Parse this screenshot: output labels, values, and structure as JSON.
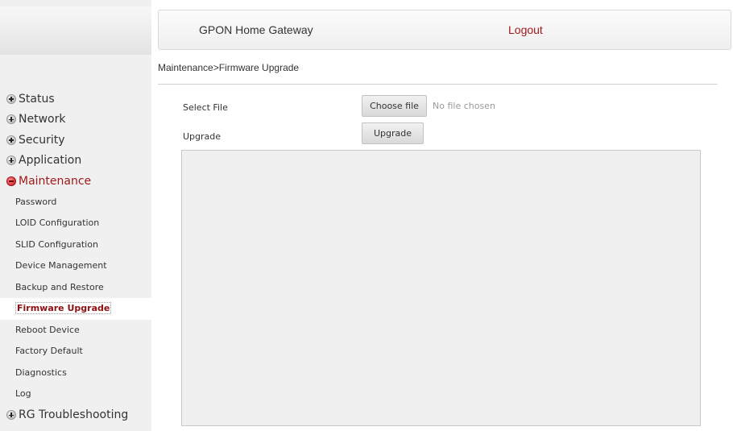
{
  "header": {
    "title": "GPON Home Gateway",
    "logout": "Logout"
  },
  "breadcrumb": "Maintenance>Firmware Upgrade",
  "sidebar": {
    "groups_before": [
      "Status",
      "Network",
      "Security",
      "Application"
    ],
    "open_group": "Maintenance",
    "sub_items": [
      "Password",
      "LOID Configuration",
      "SLID Configuration",
      "Device Management",
      "Backup and Restore",
      "Firmware Upgrade",
      "Reboot Device",
      "Factory Default",
      "Diagnostics",
      "Log"
    ],
    "groups_after": [
      "RG Troubleshooting"
    ]
  },
  "form": {
    "select_file_label": "Select File",
    "choose_file_button": "Choose file",
    "no_file_text": "No file chosen",
    "upgrade_label": "Upgrade",
    "upgrade_button": "Upgrade"
  },
  "colors": {
    "accent": "#a11a1a",
    "sidebar_bg": "#f0f0f0"
  }
}
